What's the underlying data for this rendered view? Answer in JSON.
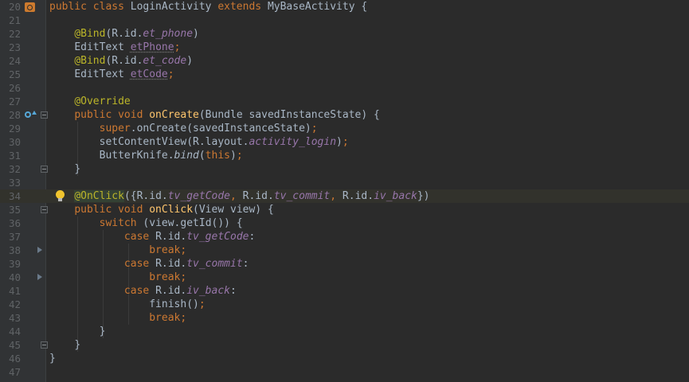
{
  "line_numbers": [
    "20",
    "21",
    "22",
    "23",
    "24",
    "25",
    "26",
    "27",
    "28",
    "29",
    "30",
    "31",
    "32",
    "33",
    "34",
    "35",
    "36",
    "37",
    "38",
    "39",
    "40",
    "41",
    "42",
    "43",
    "44",
    "45",
    "46",
    "47"
  ],
  "code": {
    "l20": {
      "kw1": "public class ",
      "cls": "LoginActivity ",
      "kw2": "extends ",
      "base": "MyBaseActivity {"
    },
    "l22": {
      "ann": "@Bind",
      "t1": "(R.id.",
      "f": "et_phone",
      "t2": ")"
    },
    "l23": {
      "t1": "EditText ",
      "v": "etPhone",
      "semi": ";"
    },
    "l24": {
      "ann": "@Bind",
      "t1": "(R.id.",
      "f": "et_code",
      "t2": ")"
    },
    "l25": {
      "t1": "EditText ",
      "v": "etCode",
      "semi": ";"
    },
    "l27": {
      "ann": "@Override"
    },
    "l28": {
      "kw": "public void ",
      "fn": "onCreate",
      "t1": "(Bundle savedInstanceState) {"
    },
    "l29": {
      "kw": "super",
      "t1": ".onCreate(savedInstanceState)",
      "semi": ";"
    },
    "l30": {
      "t1": "setContentView(R.layout.",
      "f": "activity_login",
      "t2": ")",
      "semi": ";"
    },
    "l31": {
      "t1": "ButterKnife.",
      "m": "bind",
      "t2": "(",
      "kw": "this",
      "t3": ")",
      "semi": ";"
    },
    "l32": {
      "t1": "}"
    },
    "l34": {
      "ann": "@OnClick",
      "t1": "({R.id.",
      "f1": "tv_getCode",
      "c1": ", ",
      "t2": "R.id.",
      "f2": "tv_commit",
      "c2": ", ",
      "t3": "R.id.",
      "f3": "iv_back",
      "t4": "})"
    },
    "l35": {
      "kw": "public void ",
      "fn": "onClick",
      "t1": "(View view) {"
    },
    "l36": {
      "kw": "switch ",
      "t1": "(view.getId()) {"
    },
    "l37": {
      "kw": "case ",
      "t1": "R.id.",
      "f": "tv_getCode",
      "t2": ":"
    },
    "l38": {
      "kw": "break;"
    },
    "l39": {
      "kw": "case ",
      "t1": "R.id.",
      "f": "tv_commit",
      "t2": ":"
    },
    "l40": {
      "kw": "break;"
    },
    "l41": {
      "kw": "case ",
      "t1": "R.id.",
      "f": "iv_back",
      "t2": ":"
    },
    "l42": {
      "t1": "finish()",
      "semi": ";"
    },
    "l43": {
      "kw": "break;"
    },
    "l44": {
      "t1": "}"
    },
    "l45": {
      "t1": "}"
    },
    "l46": {
      "t1": "}"
    }
  },
  "gutter_icons": {
    "l20": "class-file-icon",
    "l28": "override-method-icon",
    "l34": "intention-bulb-icon"
  },
  "colors": {
    "background": "#2b2b2b",
    "gutter": "#313335",
    "keyword": "#cc7832",
    "annotation": "#bbb529",
    "function": "#ffc66d",
    "field": "#9876aa",
    "text": "#a9b7c6",
    "line_number": "#606366"
  }
}
